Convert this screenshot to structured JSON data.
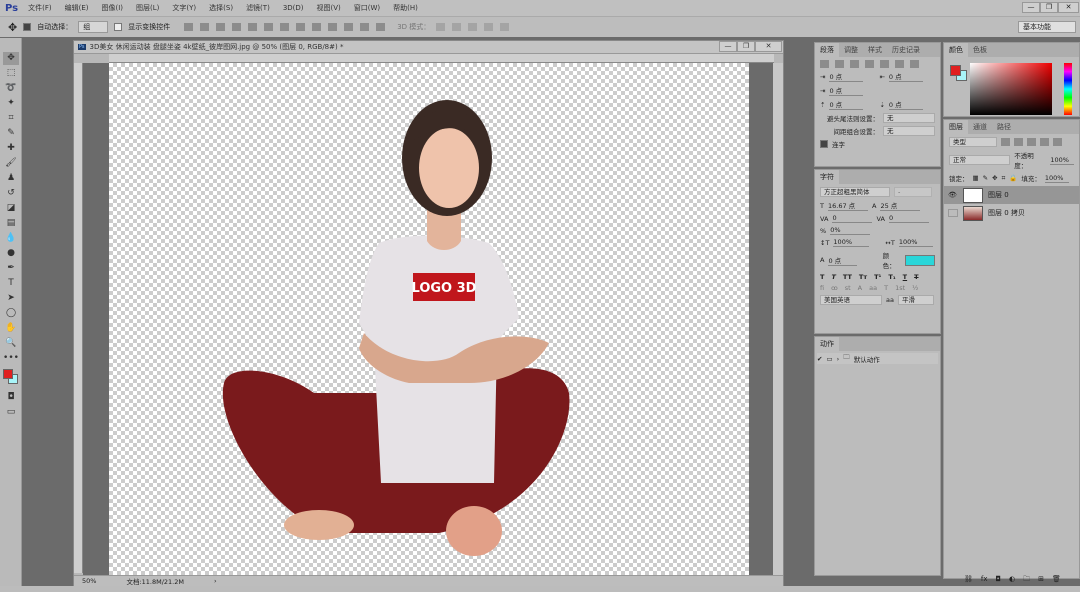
{
  "app": {
    "logo": "Ps"
  },
  "menu": [
    "文件(F)",
    "编辑(E)",
    "图像(I)",
    "图层(L)",
    "文字(Y)",
    "选择(S)",
    "滤镜(T)",
    "3D(D)",
    "视图(V)",
    "窗口(W)",
    "帮助(H)"
  ],
  "window_controls": {
    "minimize": "—",
    "restore": "❐",
    "close": "✕"
  },
  "options": {
    "auto_select_label": "自动选择：",
    "auto_select_value": "组",
    "show_transform_label": "显示变换控件",
    "mode_3d_label": "3D 模式：",
    "workspace": "基本功能"
  },
  "document": {
    "title": "3D美女 休闲运动装 盘腿坐姿 4k壁纸_彼岸图网.jpg @ 50% (图层 0, RGB/8#) *",
    "zoom": "50%",
    "doc_size": "文档:11.8M/21.2M",
    "shirt_logo": "LOGO 3D"
  },
  "paragraph": {
    "tabs": [
      "段落",
      "调整",
      "样式",
      "历史记录"
    ],
    "indent_left": "0 点",
    "indent_right": "0 点",
    "first_line": "0 点",
    "space_before": "0 点",
    "space_after": "0 点",
    "kinsoku_label": "避头尾法则设置：",
    "kinsoku_value": "无",
    "mojikumi_label": "间距组合设置：",
    "mojikumi_value": "无",
    "hyphenate_label": "连字",
    "hyphenate_checked": true
  },
  "character": {
    "tab": "字符",
    "font": "方正超粗黑简体",
    "style": "-",
    "size": "16.67 点",
    "leading": "25 点",
    "kerning": "0",
    "tracking": "0",
    "scale_label": "0%",
    "v_scale": "100%",
    "h_scale": "100%",
    "baseline": "0 点",
    "color_label": "颜色：",
    "color": "#2ad6d9",
    "language": "美国英语",
    "aa": "平滑"
  },
  "actions": {
    "tab": "动作",
    "item": "默认动作"
  },
  "color_panel": {
    "tabs": [
      "颜色",
      "色板"
    ],
    "fg": "#e02020",
    "bg": "#a8f4f8"
  },
  "layers": {
    "tabs": [
      "图层",
      "通道",
      "路径"
    ],
    "filter": "类型",
    "blend": "正常",
    "opacity_label": "不透明度：",
    "opacity": "100%",
    "lock_label": "锁定：",
    "fill_label": "填充：",
    "fill": "100%",
    "items": [
      {
        "name": "图层 0",
        "visible": true,
        "selected": true
      },
      {
        "name": "图层 0 拷贝",
        "visible": false,
        "selected": false
      }
    ]
  }
}
